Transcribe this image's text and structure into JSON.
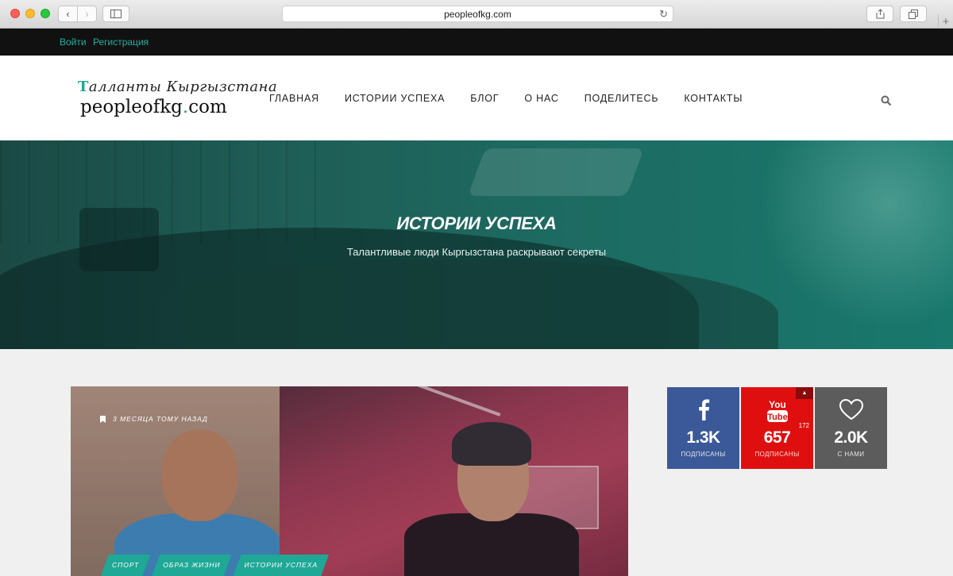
{
  "browser": {
    "url": "peopleofkg.com"
  },
  "topbar": {
    "login": "Войти",
    "register": "Регистрация"
  },
  "header": {
    "logo_tagline": "алланты Кыргызстана",
    "logo_tagline_initial": "Т",
    "logo_domain": "peopleofkg",
    "logo_dot": ".",
    "logo_tld": "com",
    "nav": [
      "ГЛАВНАЯ",
      "ИСТОРИИ УСПЕХА",
      "БЛОГ",
      "О НАС",
      "ПОДЕЛИТЕСЬ",
      "КОНТАКТЫ"
    ]
  },
  "hero": {
    "title": "ИСТОРИИ УСПЕХА",
    "subtitle": "Талантливые люди Кыргызстана раскрывают секреты"
  },
  "post": {
    "date": "3 МЕСЯЦА ТОМУ НАЗАД",
    "tags": [
      "СПОРТ",
      "ОБРАЗ ЖИЗНИ",
      "ИСТОРИИ УСПЕХА"
    ]
  },
  "social": {
    "facebook": {
      "count": "1.3K",
      "label": "ПОДПИСАНЫ",
      "color": "#3b5998"
    },
    "youtube": {
      "count": "657",
      "label": "ПОДПИСАНЫ",
      "badge": "172",
      "icon_text": "You\nTube",
      "color": "#e00f0f"
    },
    "likes": {
      "count": "2.0K",
      "label": "С НАМИ",
      "color": "#5c5c5c"
    }
  }
}
